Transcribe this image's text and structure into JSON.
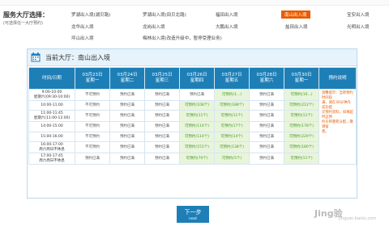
{
  "hall_select": {
    "title": "服务大厅选择：",
    "subtitle": "(可选择任一大厅预约)",
    "halls": [
      {
        "label": "罗湖出入境(湖贝路)"
      },
      {
        "label": "罗湖出入境(田贝北路)"
      },
      {
        "label": "福田出入境"
      },
      {
        "label": "南山出入境",
        "active": true
      },
      {
        "label": "宝安出入境"
      },
      {
        "label": "龙华出入境"
      },
      {
        "label": "龙岗出入境"
      },
      {
        "label": "大鹏出入境"
      },
      {
        "label": "盐田出入境"
      },
      {
        "label": "光明出入境"
      },
      {
        "label": "坪山出入境"
      },
      {
        "label": "梅林出入境(改造升级中，暂停受理业务)"
      }
    ]
  },
  "panel": {
    "title": "当前大厅：南山出入境"
  },
  "table": {
    "header_time": "时间/日期",
    "header_note": "预约说明",
    "days": [
      {
        "date": "03月23日",
        "weekday": "星期一"
      },
      {
        "date": "03月24日",
        "weekday": "星期二"
      },
      {
        "date": "03月25日",
        "weekday": "星期三"
      },
      {
        "date": "03月26日",
        "weekday": "星期四"
      },
      {
        "date": "03月27日",
        "weekday": "星期五"
      },
      {
        "date": "03月28日",
        "weekday": "星期六"
      },
      {
        "date": "03月30日",
        "weekday": "星期一"
      }
    ],
    "rows": [
      {
        "time": [
          "9:00-10:00",
          "星期六(09:30-10:00)"
        ],
        "cells": [
          {
            "s": "na",
            "t": "不可预约"
          },
          {
            "s": "full",
            "t": "预约已满"
          },
          {
            "s": "full",
            "t": "预约已满"
          },
          {
            "s": "full",
            "t": "预约已满"
          },
          {
            "s": "ok",
            "t": "可预约(1...)"
          },
          {
            "s": "full",
            "t": "预约已满"
          },
          {
            "s": "ok",
            "t": "可预约(16...)"
          }
        ]
      },
      {
        "time": [
          "10:00-11:00"
        ],
        "cells": [
          {
            "s": "na",
            "t": "不可预约"
          },
          {
            "s": "full",
            "t": "预约已满"
          },
          {
            "s": "full",
            "t": "预约已满"
          },
          {
            "s": "ok",
            "t": "可预约(108个)"
          },
          {
            "s": "ok",
            "t": "可预约(188个)"
          },
          {
            "s": "full",
            "t": "预约已满"
          },
          {
            "s": "ok",
            "t": "可预约(212个)"
          }
        ]
      },
      {
        "time": [
          "11:00-11:45",
          "星期六(11:00-12:00)"
        ],
        "cells": [
          {
            "s": "na",
            "t": "不可预约"
          },
          {
            "s": "full",
            "t": "预约已满"
          },
          {
            "s": "full",
            "t": "预约已满"
          },
          {
            "s": "ok",
            "t": "可预约(11个)"
          },
          {
            "s": "ok",
            "t": "可预约(11个)"
          },
          {
            "s": "full",
            "t": "预约已满"
          },
          {
            "s": "ok",
            "t": "可预约(11个)"
          }
        ]
      },
      {
        "time": [
          "14:00-15:00"
        ],
        "cells": [
          {
            "s": "na",
            "t": "不可预约"
          },
          {
            "s": "full",
            "t": "预约已满"
          },
          {
            "s": "full",
            "t": "预约已满"
          },
          {
            "s": "ok",
            "t": "可预约(114个)"
          },
          {
            "s": "ok",
            "t": "可预约(17个)"
          },
          {
            "s": "full",
            "t": "预约已满"
          },
          {
            "s": "ok",
            "t": "可预约(178个)"
          }
        ]
      },
      {
        "time": [
          "15:00-16:00"
        ],
        "cells": [
          {
            "s": "na",
            "t": "不可预约"
          },
          {
            "s": "full",
            "t": "预约已满"
          },
          {
            "s": "full",
            "t": "预约已满"
          },
          {
            "s": "ok",
            "t": "可预约(114个)"
          },
          {
            "s": "ok",
            "t": "可预约(14个)"
          },
          {
            "s": "full",
            "t": "预约已满"
          },
          {
            "s": "ok",
            "t": "可预约(229个)"
          }
        ]
      },
      {
        "time": [
          "16:00-17:00",
          "周六周日不休息"
        ],
        "cells": [
          {
            "s": "na",
            "t": "不可预约"
          },
          {
            "s": "full",
            "t": "预约已满"
          },
          {
            "s": "full",
            "t": "预约已满"
          },
          {
            "s": "ok",
            "t": "可预约(151个)"
          },
          {
            "s": "ok",
            "t": "可预约(138个)"
          },
          {
            "s": "full",
            "t": "预约已满"
          },
          {
            "s": "ok",
            "t": "可预约(180个)"
          }
        ]
      },
      {
        "time": [
          "17:00-17:45",
          "周六周日不休息"
        ],
        "cells": [
          {
            "s": "full",
            "t": "预约已满"
          },
          {
            "s": "full",
            "t": "预约已满"
          },
          {
            "s": "full",
            "t": "预约已满"
          },
          {
            "s": "ok",
            "t": "可预约(70个)"
          },
          {
            "s": "ok",
            "t": "可预约(5个)"
          },
          {
            "s": "full",
            "t": "预约已满"
          },
          {
            "s": "ok",
            "t": "可预约(11个)"
          }
        ]
      }
    ],
    "note_lines": [
      "温馨提示：当周预约时间段",
      "满，请在30分钟内成功提",
      "交预约资料，如果超时这预",
      "约号将重新分配，敬请留",
      "意。"
    ]
  },
  "next_button": {
    "label": "下一步",
    "sublabel": "next"
  },
  "watermark": {
    "brand": "Jing验",
    "url": "jingyan.baidu.com"
  },
  "colors": {
    "accent": "#1e7fb6",
    "active_hall": "#e65c00",
    "available_bg": "#e8f5da",
    "available_text": "#4a9a2a"
  }
}
